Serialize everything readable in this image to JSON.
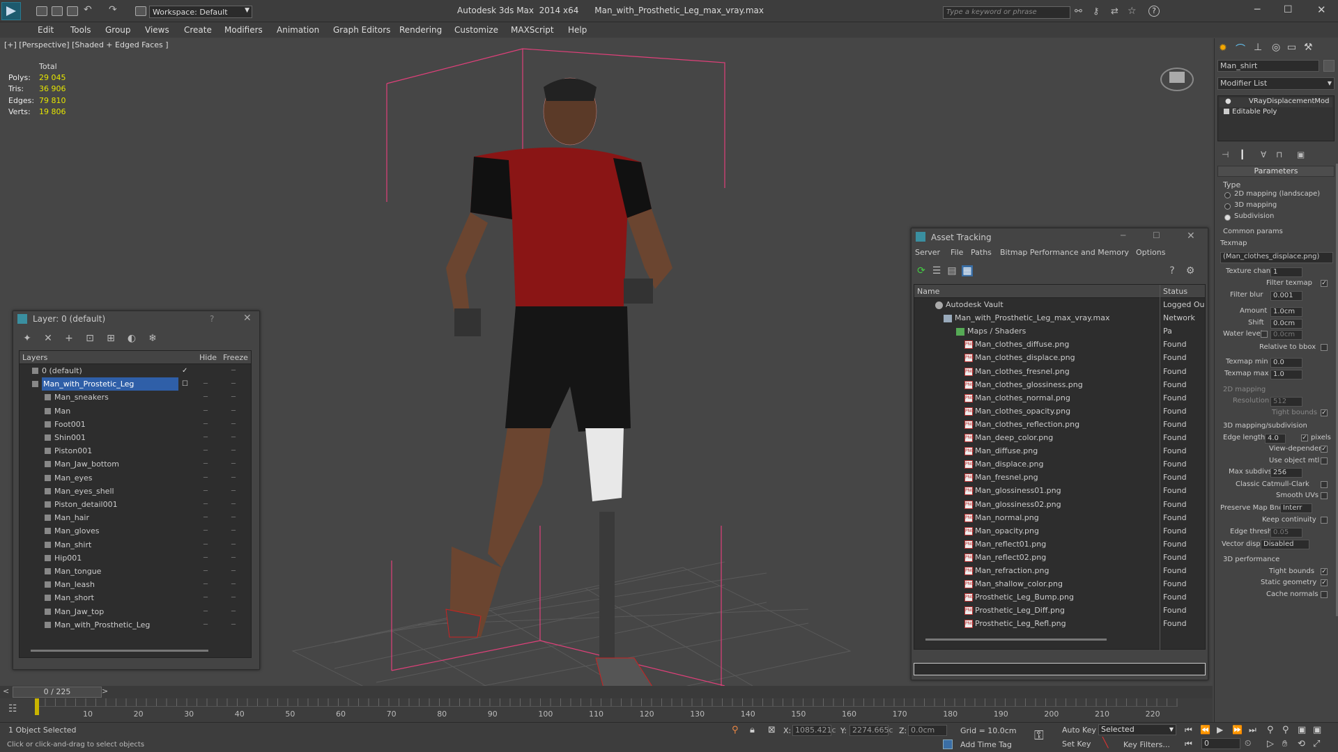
{
  "app": {
    "title": "Autodesk 3ds Max  2014 x64      Man_with_Prosthetic_Leg_max_vray.max",
    "workspace": "Workspace: Default",
    "search_placeholder": "Type a keyword or phrase"
  },
  "menu": [
    "Edit",
    "Tools",
    "Group",
    "Views",
    "Create",
    "Modifiers",
    "Animation",
    "Graph Editors",
    "Rendering",
    "Customize",
    "MAXScript",
    "Help"
  ],
  "viewport": {
    "label": "[+] [Perspective] [Shaded + Edged Faces ]",
    "stats": {
      "header": "Total",
      "rows": [
        {
          "label": "Polys:",
          "value": "29 045"
        },
        {
          "label": "Tris:",
          "value": "36 906"
        },
        {
          "label": "Edges:",
          "value": "79 810"
        },
        {
          "label": "Verts:",
          "value": "19 806"
        }
      ]
    }
  },
  "layer_window": {
    "title": "Layer: 0 (default)",
    "help": "?",
    "columns": {
      "layers": "Layers",
      "hide": "Hide",
      "freeze": "Freeze"
    },
    "rows": [
      {
        "name": "0 (default)",
        "level": 0
      },
      {
        "name": "Man_with_Prostetic_Leg",
        "level": 0
      },
      {
        "name": "Man_sneakers",
        "level": 1
      },
      {
        "name": "Man",
        "level": 1
      },
      {
        "name": "Foot001",
        "level": 1
      },
      {
        "name": "Shin001",
        "level": 1
      },
      {
        "name": "Piston001",
        "level": 1
      },
      {
        "name": "Man_Jaw_bottom",
        "level": 1
      },
      {
        "name": "Man_eyes",
        "level": 1
      },
      {
        "name": "Man_eyes_shell",
        "level": 1
      },
      {
        "name": "Piston_detail001",
        "level": 1
      },
      {
        "name": "Man_hair",
        "level": 1
      },
      {
        "name": "Man_gloves",
        "level": 1
      },
      {
        "name": "Man_shirt",
        "level": 1
      },
      {
        "name": "Hip001",
        "level": 1
      },
      {
        "name": "Man_tongue",
        "level": 1
      },
      {
        "name": "Man_leash",
        "level": 1
      },
      {
        "name": "Man_short",
        "level": 1
      },
      {
        "name": "Man_Jaw_top",
        "level": 1
      },
      {
        "name": "Man_with_Prosthetic_Leg",
        "level": 1
      }
    ]
  },
  "asset_window": {
    "title": "Asset Tracking",
    "menu": [
      "Server",
      "File",
      "Paths",
      "Bitmap Performance and Memory",
      "Options"
    ],
    "columns": {
      "name": "Name",
      "status": "Status"
    },
    "rows": [
      {
        "name": "Autodesk Vault",
        "status": "Logged Ou",
        "level": 0
      },
      {
        "name": "Man_with_Prosthetic_Leg_max_vray.max",
        "status": "Network Pa",
        "level": 1
      },
      {
        "name": "Maps / Shaders",
        "status": "",
        "level": 2
      },
      {
        "name": "Man_clothes_diffuse.png",
        "status": "Found",
        "level": 3
      },
      {
        "name": "Man_clothes_displace.png",
        "status": "Found",
        "level": 3
      },
      {
        "name": "Man_clothes_fresnel.png",
        "status": "Found",
        "level": 3
      },
      {
        "name": "Man_clothes_glossiness.png",
        "status": "Found",
        "level": 3
      },
      {
        "name": "Man_clothes_normal.png",
        "status": "Found",
        "level": 3
      },
      {
        "name": "Man_clothes_opacity.png",
        "status": "Found",
        "level": 3
      },
      {
        "name": "Man_clothes_reflection.png",
        "status": "Found",
        "level": 3
      },
      {
        "name": "Man_deep_color.png",
        "status": "Found",
        "level": 3
      },
      {
        "name": "Man_diffuse.png",
        "status": "Found",
        "level": 3
      },
      {
        "name": "Man_displace.png",
        "status": "Found",
        "level": 3
      },
      {
        "name": "Man_fresnel.png",
        "status": "Found",
        "level": 3
      },
      {
        "name": "Man_glossiness01.png",
        "status": "Found",
        "level": 3
      },
      {
        "name": "Man_glossiness02.png",
        "status": "Found",
        "level": 3
      },
      {
        "name": "Man_normal.png",
        "status": "Found",
        "level": 3
      },
      {
        "name": "Man_opacity.png",
        "status": "Found",
        "level": 3
      },
      {
        "name": "Man_reflect01.png",
        "status": "Found",
        "level": 3
      },
      {
        "name": "Man_reflect02.png",
        "status": "Found",
        "level": 3
      },
      {
        "name": "Man_refraction.png",
        "status": "Found",
        "level": 3
      },
      {
        "name": "Man_shallow_color.png",
        "status": "Found",
        "level": 3
      },
      {
        "name": "Prosthetic_Leg_Bump.png",
        "status": "Found",
        "level": 3
      },
      {
        "name": "Prosthetic_Leg_Diff.png",
        "status": "Found",
        "level": 3
      },
      {
        "name": "Prosthetic_Leg_Refl.png",
        "status": "Found",
        "level": 3
      }
    ]
  },
  "command_panel": {
    "object_name": "Man_shirt",
    "modifier_list": "Modifier List",
    "stack": [
      "VRayDisplacementMod",
      "Editable Poly"
    ],
    "parameters_title": "Parameters",
    "type_label": "Type",
    "type_options": [
      "2D mapping (landscape)",
      "3D mapping",
      "Subdivision"
    ],
    "common_params": "Common params",
    "texmap_label": "Texmap",
    "texmap_value": "(Man_clothes_displace.png)",
    "texture_chan_label": "Texture chan",
    "texture_chan_value": "1",
    "filter_texmap": "Filter texmap",
    "filter_blur_label": "Filter blur",
    "filter_blur_value": "0.001",
    "amount_label": "Amount",
    "amount_value": "1.0cm",
    "shift_label": "Shift",
    "shift_value": "0.0cm",
    "water_level_label": "Water level",
    "water_level_value": "0.0cm",
    "relative_to_bbox": "Relative to bbox",
    "texmap_min_label": "Texmap min",
    "texmap_min_value": "0.0",
    "texmap_max_label": "Texmap max",
    "texmap_max_value": "1.0",
    "mapping2d_title": "2D mapping",
    "resolution_label": "Resolution",
    "resolution_value": "512",
    "tight_bounds": "Tight bounds",
    "mapping3d_title": "3D mapping/subdivision",
    "edge_length_label": "Edge length",
    "edge_length_value": "4.0",
    "pixels": "pixels",
    "view_dependent": "View-dependent",
    "use_object_mtl": "Use object mtl",
    "max_subdivs_label": "Max subdivs",
    "max_subdivs_value": "256",
    "classic_catmull": "Classic Catmull-Clark",
    "smooth_uvs": "Smooth UVs",
    "preserve_map_label": "Preserve Map Bnd",
    "preserve_map_value": "Interr",
    "keep_continuity": "Keep continuity",
    "edge_thresh_label": "Edge thresh",
    "edge_thresh_value": "0.05",
    "vector_displ_label": "Vector displ",
    "vector_displ_value": "Disabled",
    "perf_title": "3D performance",
    "perf_tight_bounds": "Tight bounds",
    "static_geometry": "Static geometry",
    "cache_normals": "Cache normals"
  },
  "timeline": {
    "frame_counter": "0 / 225",
    "ticks": [
      "10",
      "20",
      "30",
      "40",
      "50",
      "60",
      "70",
      "80",
      "90",
      "100",
      "110",
      "120",
      "130",
      "140",
      "150",
      "160",
      "170",
      "180",
      "190",
      "200",
      "210",
      "220"
    ]
  },
  "status": {
    "selection": "1 Object Selected",
    "prompt": "Click or click-and-drag to select objects",
    "x_label": "X:",
    "x_value": "1085.421c",
    "y_label": "Y:",
    "y_value": "2274.665c",
    "z_label": "Z:",
    "z_value": "0.0cm",
    "grid": "Grid = 10.0cm",
    "add_time_tag": "Add Time Tag",
    "auto_key": "Auto Key",
    "selected_dropdown": "Selected",
    "set_key": "Set Key",
    "key_filters": "Key Filters...",
    "frame_value": "0"
  }
}
